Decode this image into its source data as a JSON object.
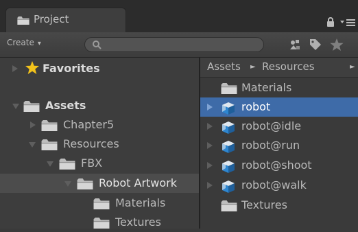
{
  "tab": {
    "title": "Project"
  },
  "toolbar": {
    "create_label": "Create"
  },
  "left": {
    "favorites": "Favorites",
    "assets": "Assets",
    "chapter5": "Chapter5",
    "resources": "Resources",
    "fbx": "FBX",
    "robot_artwork": "Robot Artwork",
    "materials": "Materials",
    "textures": "Textures"
  },
  "right": {
    "breadcrumb": [
      "Assets",
      "Resources"
    ],
    "items": {
      "materials": "Materials",
      "robot": "robot",
      "robot_idle": "robot@idle",
      "robot_run": "robot@run",
      "robot_shoot": "robot@shoot",
      "robot_walk": "robot@walk",
      "textures": "Textures"
    }
  },
  "colors": {
    "selection_blue": "#3e6ba8",
    "folder": "#c9c9c9",
    "star": "#f2c21b",
    "cube_blue": "#2e86d0"
  },
  "icons": [
    "folder-icon",
    "lock-icon",
    "tab-menu-icon",
    "search-icon",
    "label-icon",
    "tag-icon",
    "star-icon",
    "cube-icon"
  ]
}
